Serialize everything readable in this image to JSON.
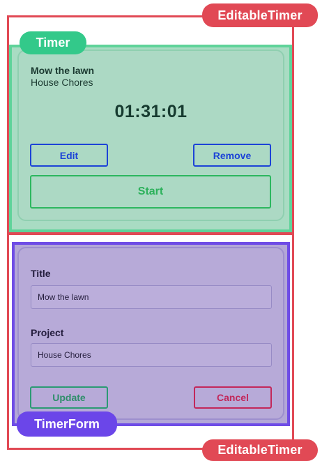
{
  "labels": {
    "editable_timer_top": "EditableTimer",
    "editable_timer_bottom": "EditableTimer",
    "timer": "Timer",
    "timer_form": "TimerForm"
  },
  "timer": {
    "title": "Mow the lawn",
    "project": "House Chores",
    "elapsed": "01:31:01",
    "edit_label": "Edit",
    "remove_label": "Remove",
    "start_label": "Start"
  },
  "timer_form": {
    "title_label": "Title",
    "title_value": "Mow the lawn",
    "project_label": "Project",
    "project_value": "House Chores",
    "update_label": "Update",
    "cancel_label": "Cancel"
  },
  "colors": {
    "editable_timer": "#e14955",
    "timer": "#33c98a",
    "timer_form": "#6b46e9"
  }
}
